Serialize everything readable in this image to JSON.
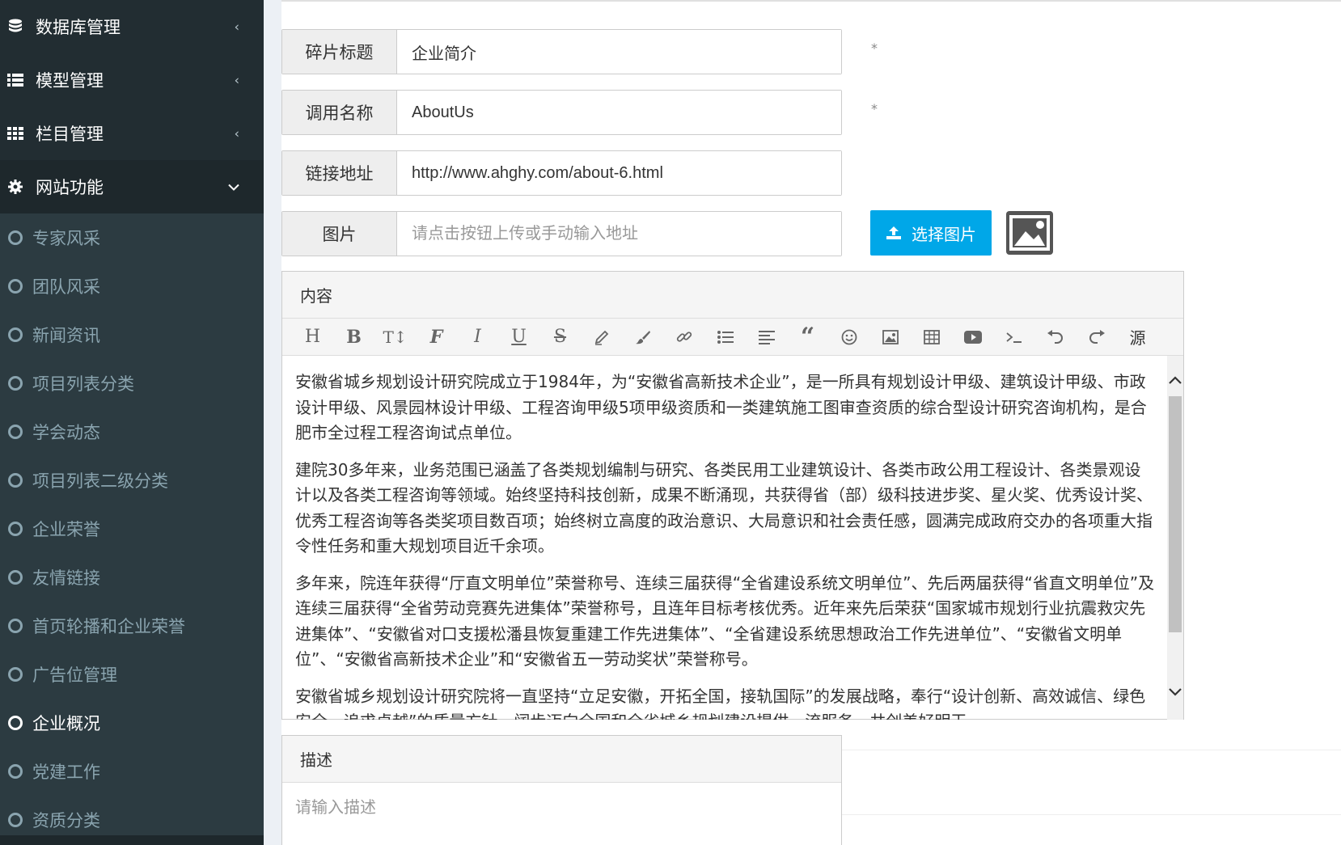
{
  "sidebar": {
    "groups": [
      {
        "label": "数据库管理",
        "icon": "database-icon",
        "expanded": false
      },
      {
        "label": "模型管理",
        "icon": "list-icon",
        "expanded": false
      },
      {
        "label": "栏目管理",
        "icon": "grid-icon",
        "expanded": false
      },
      {
        "label": "网站功能",
        "icon": "gear-icon",
        "expanded": true
      }
    ],
    "items": [
      {
        "label": "专家风采"
      },
      {
        "label": "团队风采"
      },
      {
        "label": "新闻资讯"
      },
      {
        "label": "项目列表分类"
      },
      {
        "label": "学会动态"
      },
      {
        "label": "项目列表二级分类"
      },
      {
        "label": "企业荣誉"
      },
      {
        "label": "友情链接"
      },
      {
        "label": "首页轮播和企业荣誉"
      },
      {
        "label": "广告位管理"
      },
      {
        "label": "企业概况",
        "current": true
      },
      {
        "label": "党建工作"
      },
      {
        "label": "资质分类"
      }
    ]
  },
  "form": {
    "title": {
      "label": "碎片标题",
      "value": "企业简介",
      "required": "*"
    },
    "call_name": {
      "label": "调用名称",
      "value": "AboutUs",
      "required": "*"
    },
    "link": {
      "label": "链接地址",
      "value": "http://www.ahghy.com/about-6.html"
    },
    "image": {
      "label": "图片",
      "placeholder": "请点击按钮上传或手动输入地址",
      "button": "选择图片"
    },
    "content": {
      "label": "内容",
      "toolbar": [
        "H",
        "B",
        "T↕",
        "F",
        "I",
        "U",
        "S",
        "pencil",
        "brush",
        "link",
        "ul",
        "align",
        "quote",
        "emoji",
        "image",
        "table",
        "video",
        "code",
        "undo",
        "redo",
        "源"
      ],
      "source_label": "源",
      "paragraphs": [
        " 安徽省城乡规划设计研究院成立于1984年，为“安徽省高新技术企业”，是一所具有规划设计甲级、建筑设计甲级、市政设计甲级、风景园林设计甲级、工程咨询甲级5项甲级资质和一类建筑施工图审查资质的综合型设计研究咨询机构，是合肥市全过程工程咨询试点单位。",
        " 建院30多年来，业务范围已涵盖了各类规划编制与研究、各类民用工业建筑设计、各类市政公用工程设计、各类景观设计以及各类工程咨询等领域。始终坚持科技创新，成果不断涌现，共获得省（部）级科技进步奖、星火奖、优秀设计奖、优秀工程咨询等各类奖项目数百项；始终树立高度的政治意识、大局意识和社会责任感，圆满完成政府交办的各项重大指令性任务和重大规划项目近千余项。",
        " 多年来，院连年获得“厅直文明单位”荣誉称号、连续三届获得“全省建设系统文明单位”、先后两届获得“省直文明单位”及连续三届获得“全省劳动竞赛先进集体”荣誉称号，且连年目标考核优秀。近年来先后荣获“国家城市规划行业抗震救灾先进集体”、“安徽省对口支援松潘县恢复重建工作先进集体”、“全省建设系统思想政治工作先进单位”、“安徽省文明单位”、“安徽省高新技术企业”和“安徽省五一劳动奖状”荣誉称号。",
        " 安徽省城乡规划设计研究院将一直坚持“立足安徽，开拓全国，接轨国际”的发展战略，奉行“设计创新、高效诚信、绿色安全、追求卓越”的质量方针，阔步迈向全国和全省城乡规划建设提供一流服务，共创美好明天。"
      ]
    },
    "description": {
      "label": "描述",
      "placeholder": "请输入描述"
    }
  },
  "colors": {
    "sidebar_bg": "#222d32",
    "accent": "#00a7e8"
  }
}
